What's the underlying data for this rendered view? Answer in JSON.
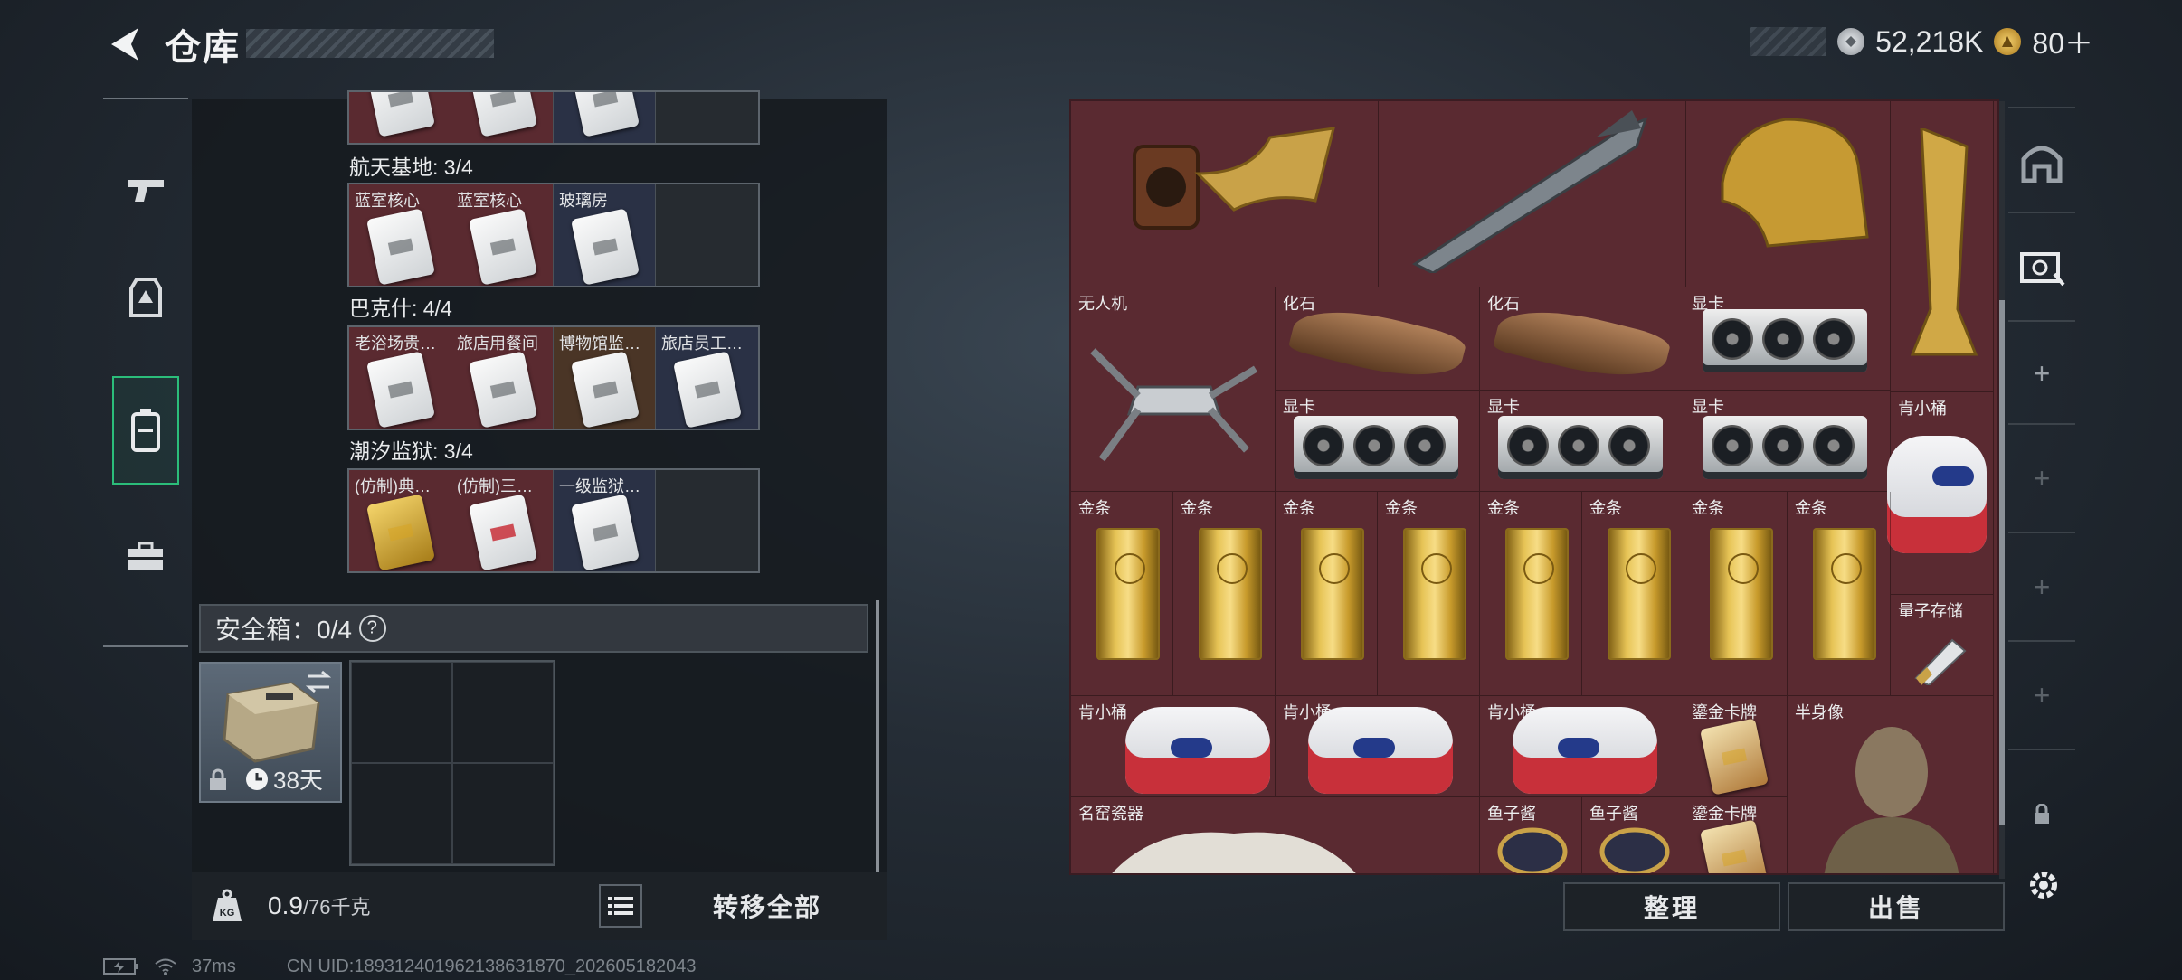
{
  "header": {
    "title": "仓库",
    "currency": [
      {
        "icon": "silver-coin-icon",
        "value": "52,218K",
        "color": "#b9bec4"
      },
      {
        "icon": "gold-coin-icon",
        "value": "80＋",
        "color": "#d6a83a"
      }
    ]
  },
  "left_rail": [
    {
      "icon": "gun-icon"
    },
    {
      "icon": "armor-icon"
    },
    {
      "icon": "backpack-icon",
      "active": true
    },
    {
      "icon": "toolbox-icon"
    }
  ],
  "groups": [
    {
      "label": "航天基地: 3/4",
      "items": [
        {
          "name": "蓝室核心",
          "bg": "red"
        },
        {
          "name": "蓝室核心",
          "bg": "red"
        },
        {
          "name": "玻璃房",
          "bg": "blue"
        },
        {
          "name": "",
          "bg": "gray"
        }
      ]
    },
    {
      "label": "巴克什: 4/4",
      "items": [
        {
          "name": "老浴场贵…",
          "bg": "red"
        },
        {
          "name": "旅店用餐间",
          "bg": "red"
        },
        {
          "name": "博物馆监…",
          "bg": "brown"
        },
        {
          "name": "旅店员工…",
          "bg": "blue"
        }
      ]
    },
    {
      "label": "潮汐监狱: 3/4",
      "items": [
        {
          "name": "(仿制)典…",
          "bg": "red"
        },
        {
          "name": "(仿制)三…",
          "bg": "red"
        },
        {
          "name": "一级监狱…",
          "bg": "blue"
        },
        {
          "name": "",
          "bg": "gray"
        }
      ]
    }
  ],
  "safe_box": {
    "label": "安全箱：0/4",
    "help": "?",
    "duration": "38天"
  },
  "weight": {
    "value": "0.9",
    "unit": "/76千克"
  },
  "buttons": {
    "transfer_all": "转移全部",
    "sort": "整理",
    "sell": "出售"
  },
  "stash": [
    {
      "name": "无人机"
    },
    {
      "name": "化石"
    },
    {
      "name": "化石"
    },
    {
      "name": "显卡"
    },
    {
      "name": "显卡"
    },
    {
      "name": "显卡"
    },
    {
      "name": "显卡"
    },
    {
      "name": "肯小桶"
    },
    {
      "name": "金条"
    },
    {
      "name": "金条"
    },
    {
      "name": "金条"
    },
    {
      "name": "金条"
    },
    {
      "name": "金条"
    },
    {
      "name": "金条"
    },
    {
      "name": "金条"
    },
    {
      "name": "金条"
    },
    {
      "name": "量子存储"
    },
    {
      "name": "肯小桶"
    },
    {
      "name": "肯小桶"
    },
    {
      "name": "肯小桶"
    },
    {
      "name": "鎏金卡牌"
    },
    {
      "name": "半身像"
    },
    {
      "name": "名窑瓷器"
    },
    {
      "name": "鱼子酱"
    },
    {
      "name": "鱼子酱"
    },
    {
      "name": "鎏金卡牌"
    }
  ],
  "status_bar": {
    "ping": "37ms",
    "uid": "CN UID:18931240196213863187​0_202605182043"
  }
}
